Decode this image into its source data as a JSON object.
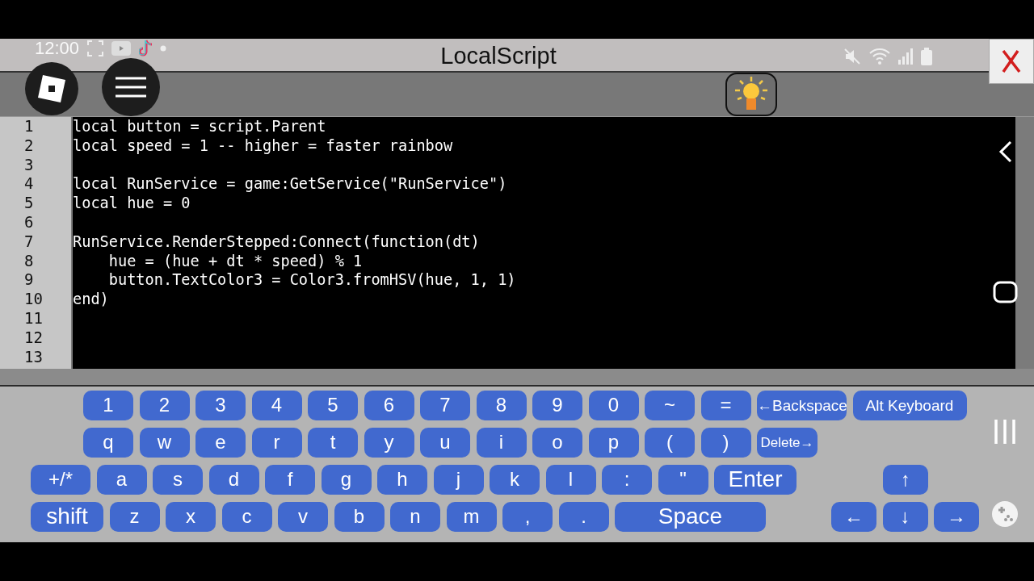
{
  "status_bar": {
    "time": "12:00"
  },
  "window": {
    "title": "LocalScript"
  },
  "editor": {
    "lines": [
      {
        "number": "1",
        "text": "local button = script.Parent"
      },
      {
        "number": "2",
        "text": "local speed = 1 -- higher = faster rainbow"
      },
      {
        "number": "3"
      },
      {
        "number": "4",
        "text": "local RunService = game:GetService(\"RunService\")"
      },
      {
        "number": "5",
        "text": "local hue = 0"
      },
      {
        "number": "6"
      },
      {
        "number": "7",
        "text": "RunService.RenderStepped:Connect(function(dt)"
      },
      {
        "number": "8",
        "text": "    hue = (hue + dt * speed) % 1"
      },
      {
        "number": "9",
        "text": "    button.TextColor3 = Color3.fromHSV(hue, 1, 1)"
      },
      {
        "number": "10",
        "text": "end)"
      },
      {
        "number": "11"
      },
      {
        "number": "12"
      },
      {
        "number": "13"
      }
    ]
  },
  "keyboard": {
    "rows": [
      {
        "keys": [
          "1",
          "2",
          "3",
          "4",
          "5",
          "6",
          "7",
          "8",
          "9",
          "0",
          "~",
          "=",
          "←Backspace",
          "Alt Keyboard"
        ]
      },
      {
        "keys": [
          "q",
          "w",
          "e",
          "r",
          "t",
          "y",
          "u",
          "i",
          "o",
          "p",
          "(",
          ")",
          "Delete→"
        ]
      },
      {
        "keys": [
          "+/*",
          "a",
          "s",
          "d",
          "f",
          "g",
          "h",
          "j",
          "k",
          "l",
          ":",
          "\"",
          "Enter"
        ],
        "nav_keys": [
          "↑"
        ]
      },
      {
        "keys": [
          "shift",
          "z",
          "x",
          "c",
          "v",
          "b",
          "n",
          "m",
          ",",
          ".",
          "Space"
        ],
        "nav_keys": [
          "←",
          "↓",
          "→"
        ]
      }
    ]
  }
}
